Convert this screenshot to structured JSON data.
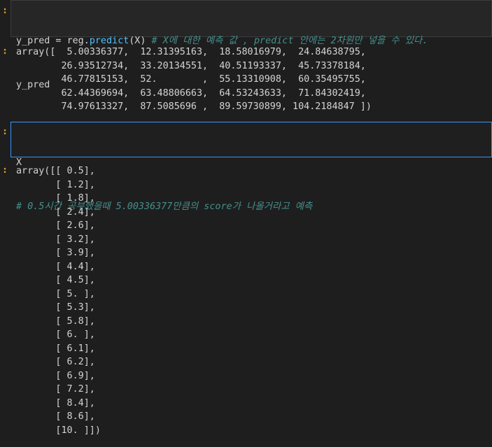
{
  "cells": [
    {
      "prompt": ":",
      "input": {
        "line1": {
          "var": "y_pred",
          "assign": " = ",
          "obj": "reg.",
          "fn": "predict",
          "args": "(X)",
          "comment": " # X에 대한 예측 값 , predict 안에는 2차원만 넣을 수 있다."
        },
        "line2": "y_pred"
      },
      "output_prompt": ":",
      "output_lines": [
        "array([  5.00336377,  12.31395163,  18.58016979,  24.84638795,",
        "        26.93512734,  33.20134551,  40.51193337,  45.73378184,",
        "        46.77815153,  52.        ,  55.13310908,  60.35495755,",
        "        62.44369694,  63.48806663,  64.53243633,  71.84302419,",
        "        74.97613327,  87.5085696 ,  89.59730899, 104.2184847 ])"
      ]
    },
    {
      "prompt": ":",
      "input": {
        "line1": "X",
        "line2": "# 0.5시간 공부했을때 5.00336377만큼의 score가 나올거라고 예측"
      },
      "output_prompt": ":",
      "output_lines": [
        "array([[ 0.5],",
        "       [ 1.2],",
        "       [ 1.8],",
        "       [ 2.4],",
        "       [ 2.6],",
        "       [ 3.2],",
        "       [ 3.9],",
        "       [ 4.4],",
        "       [ 4.5],",
        "       [ 5. ],",
        "       [ 5.3],",
        "       [ 5.8],",
        "       [ 6. ],",
        "       [ 6.1],",
        "       [ 6.2],",
        "       [ 6.9],",
        "       [ 7.2],",
        "       [ 8.4],",
        "       [ 8.6],",
        "       [10. ]])"
      ]
    }
  ]
}
